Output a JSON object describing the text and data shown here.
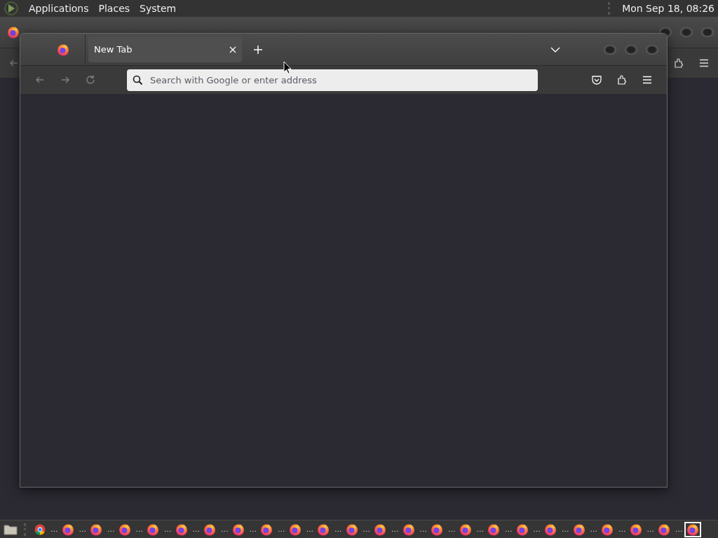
{
  "top_panel": {
    "menus": [
      "Applications",
      "Places",
      "System"
    ],
    "clock": "Mon Sep 18, 08:26"
  },
  "window": {
    "tabs": [
      {
        "label": "New Tab",
        "selected": true
      }
    ],
    "address_bar": {
      "placeholder": "Search with Google or enter address"
    },
    "nav_buttons": [
      {
        "kind": "back",
        "disabled": true
      },
      {
        "kind": "forward",
        "disabled": true
      },
      {
        "kind": "reload",
        "disabled": true
      }
    ]
  },
  "taskbar": {
    "items": [
      {
        "kind": "files",
        "selected": false
      },
      {
        "kind": "chrome",
        "selected": false
      },
      {
        "kind": "firefox",
        "label": "...",
        "selected": false
      },
      {
        "kind": "firefox",
        "label": "...",
        "selected": false
      },
      {
        "kind": "firefox",
        "label": "...",
        "selected": false
      },
      {
        "kind": "firefox",
        "label": "...",
        "selected": false
      },
      {
        "kind": "firefox",
        "label": "...",
        "selected": false
      },
      {
        "kind": "firefox",
        "label": "...",
        "selected": false
      },
      {
        "kind": "firefox",
        "label": "...",
        "selected": false
      },
      {
        "kind": "firefox",
        "label": "...",
        "selected": false
      },
      {
        "kind": "firefox",
        "label": "...",
        "selected": false
      },
      {
        "kind": "firefox",
        "label": "...",
        "selected": false
      },
      {
        "kind": "firefox",
        "label": "...",
        "selected": false
      },
      {
        "kind": "firefox",
        "label": "...",
        "selected": false
      },
      {
        "kind": "firefox",
        "label": "...",
        "selected": false
      },
      {
        "kind": "firefox",
        "label": "...",
        "selected": false
      },
      {
        "kind": "firefox",
        "label": "...",
        "selected": false
      },
      {
        "kind": "firefox",
        "label": "...",
        "selected": false
      },
      {
        "kind": "firefox",
        "label": "...",
        "selected": false
      },
      {
        "kind": "firefox",
        "label": "...",
        "selected": false
      },
      {
        "kind": "firefox",
        "label": "...",
        "selected": false
      },
      {
        "kind": "firefox",
        "label": "...",
        "selected": false
      },
      {
        "kind": "firefox",
        "label": "...",
        "selected": false
      },
      {
        "kind": "firefox",
        "label": "...",
        "selected": false
      },
      {
        "kind": "firefox",
        "label": "...",
        "selected": true
      }
    ]
  }
}
